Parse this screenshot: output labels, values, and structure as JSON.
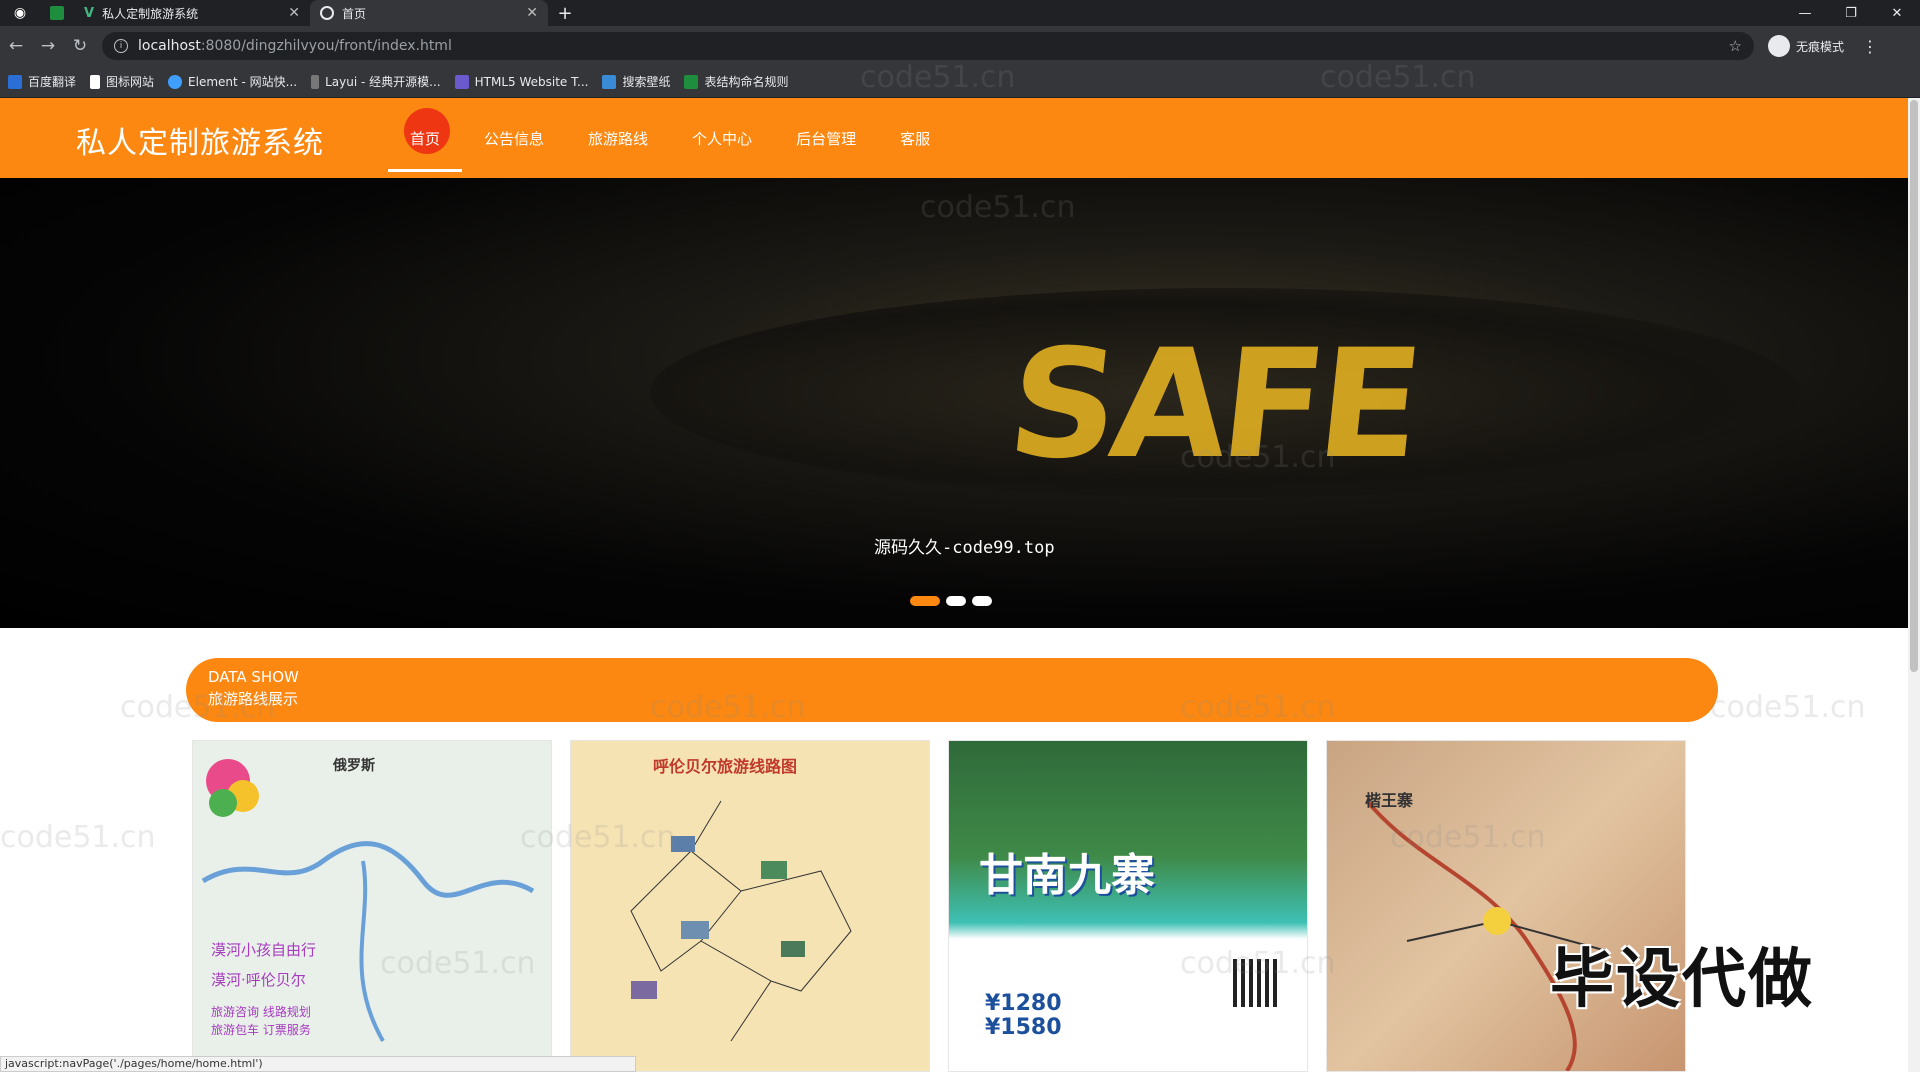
{
  "browser": {
    "tabs": [
      {
        "title": "私人定制旅游系统",
        "active": false
      },
      {
        "title": "首页",
        "active": true
      }
    ],
    "url_host": "localhost",
    "url_path": ":8080/dingzhilvyou/front/index.html",
    "profile_label": "无痕模式",
    "bookmarks": [
      "百度翻译",
      "图标网站",
      "Element - 网站快...",
      "Layui - 经典开源模...",
      "HTML5 Website T...",
      "搜索壁纸",
      "表结构命名规则"
    ]
  },
  "site": {
    "brand": "私人定制旅游系统",
    "nav": [
      "首页",
      "公告信息",
      "旅游路线",
      "个人中心",
      "后台管理",
      "客服"
    ],
    "active_nav": "首页"
  },
  "banner": {
    "caption": "源码久久-code99.top",
    "image_text": "SAFE",
    "slides": 3,
    "active_slide": 1
  },
  "section": {
    "title_en": "DATA SHOW",
    "title_zh": "旅游路线展示"
  },
  "cards": [
    {
      "heading": "俄罗斯",
      "lines": [
        "漠河小孩自由行",
        "漠河·呼伦贝尔",
        "旅游咨询 线路规划",
        "旅游包车 订票服务"
      ]
    },
    {
      "heading": "呼伦贝尔旅游线路图"
    },
    {
      "heading": "甘南九寨",
      "prices": [
        "¥1280",
        "¥1580"
      ]
    },
    {
      "heading": "楷王寨"
    }
  ],
  "overlay_text": "毕设代做",
  "status_text": "javascript:navPage('./pages/home/home.html')",
  "watermark": "code51.cn",
  "colors": {
    "accent": "#fc8811"
  }
}
